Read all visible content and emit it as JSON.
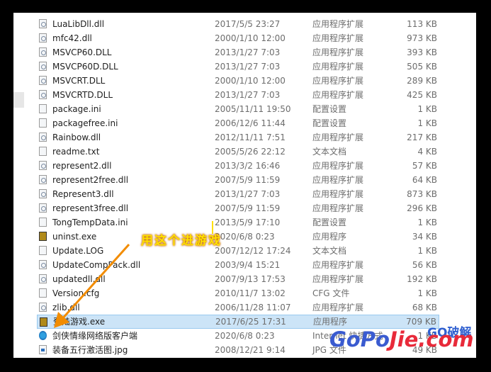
{
  "files": [
    {
      "name": "LuaLibDll.dll",
      "date": "2017/5/5 23:27",
      "type": "应用程序扩展",
      "size": "113 KB",
      "icon": "dll"
    },
    {
      "name": "mfc42.dll",
      "date": "2000/1/10 12:00",
      "type": "应用程序扩展",
      "size": "973 KB",
      "icon": "dll"
    },
    {
      "name": "MSVCP60.DLL",
      "date": "2013/1/27 7:03",
      "type": "应用程序扩展",
      "size": "393 KB",
      "icon": "dll"
    },
    {
      "name": "MSVCP60D.DLL",
      "date": "2013/1/27 7:03",
      "type": "应用程序扩展",
      "size": "505 KB",
      "icon": "dll"
    },
    {
      "name": "MSVCRT.DLL",
      "date": "2000/1/10 12:00",
      "type": "应用程序扩展",
      "size": "289 KB",
      "icon": "dll"
    },
    {
      "name": "MSVCRTD.DLL",
      "date": "2013/1/27 7:03",
      "type": "应用程序扩展",
      "size": "425 KB",
      "icon": "dll"
    },
    {
      "name": "package.ini",
      "date": "2005/11/11 19:50",
      "type": "配置设置",
      "size": "1 KB",
      "icon": "ini"
    },
    {
      "name": "packagefree.ini",
      "date": "2006/12/6 11:44",
      "type": "配置设置",
      "size": "1 KB",
      "icon": "ini"
    },
    {
      "name": "Rainbow.dll",
      "date": "2012/11/11 7:51",
      "type": "应用程序扩展",
      "size": "217 KB",
      "icon": "dll"
    },
    {
      "name": "readme.txt",
      "date": "2005/5/26 22:12",
      "type": "文本文档",
      "size": "4 KB",
      "icon": "txt"
    },
    {
      "name": "represent2.dll",
      "date": "2013/3/2 16:46",
      "type": "应用程序扩展",
      "size": "57 KB",
      "icon": "dll"
    },
    {
      "name": "represent2free.dll",
      "date": "2007/5/9 11:59",
      "type": "应用程序扩展",
      "size": "64 KB",
      "icon": "dll"
    },
    {
      "name": "Represent3.dll",
      "date": "2013/1/27 7:03",
      "type": "应用程序扩展",
      "size": "873 KB",
      "icon": "dll"
    },
    {
      "name": "represent3free.dll",
      "date": "2007/5/9 11:59",
      "type": "应用程序扩展",
      "size": "296 KB",
      "icon": "dll"
    },
    {
      "name": "TongTempData.ini",
      "date": "2013/5/9 17:10",
      "type": "配置设置",
      "size": "1 KB",
      "icon": "ini"
    },
    {
      "name": "uninst.exe",
      "date": "2020/6/8 0:23",
      "type": "应用程序",
      "size": "34 KB",
      "icon": "exe"
    },
    {
      "name": "Update.LOG",
      "date": "2007/12/12 17:24",
      "type": "文本文档",
      "size": "1 KB",
      "icon": "txt"
    },
    {
      "name": "UpdateCompPack.dll",
      "date": "2003/9/4 15:21",
      "type": "应用程序扩展",
      "size": "56 KB",
      "icon": "dll"
    },
    {
      "name": "updatedll.dll",
      "date": "2007/9/13 17:53",
      "type": "应用程序扩展",
      "size": "192 KB",
      "icon": "dll"
    },
    {
      "name": "Version.cfg",
      "date": "2010/11/7 13:02",
      "type": "CFG 文件",
      "size": "1 KB",
      "icon": "file"
    },
    {
      "name": "zlib.dll",
      "date": "2006/11/28 11:07",
      "type": "应用程序扩展",
      "size": "68 KB",
      "icon": "dll"
    },
    {
      "name": "登陆游戏.exe",
      "date": "2017/6/25 17:31",
      "type": "应用程序",
      "size": "709 KB",
      "icon": "exe",
      "selected": true
    },
    {
      "name": "剑侠情缘网络版客户端",
      "date": "2020/6/8 0:23",
      "type": "Internet 快捷方式",
      "size": "1 KB",
      "icon": "net"
    },
    {
      "name": "装备五行激活图.jpg",
      "date": "2008/12/21 9:14",
      "type": "JPG 文件",
      "size": "49 KB",
      "icon": "jpg"
    }
  ],
  "annotation": {
    "text": "用这个进游戏",
    "color": "#ffe000",
    "arrow_color": "#f28c00"
  },
  "watermark": {
    "top": "GO破解",
    "go": "GoPo",
    "jie": "Jie.com"
  },
  "colors": {
    "selection": "#cce4f7",
    "selection_border": "#99c9ef"
  }
}
